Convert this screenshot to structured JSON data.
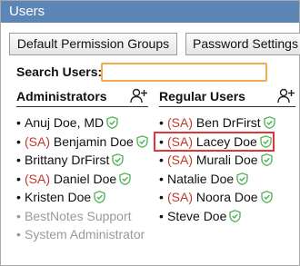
{
  "window": {
    "title": "Users"
  },
  "tabs": [
    {
      "label": "Default Permission Groups"
    },
    {
      "label": "Password Settings"
    }
  ],
  "search": {
    "label": "Search Users:",
    "value": "",
    "placeholder": ""
  },
  "administrators": {
    "title": "Administrators",
    "add_icon": "add-user-icon",
    "items": [
      {
        "prefix": "",
        "name": "Anuj Doe, MD",
        "verified": true,
        "disabled": false
      },
      {
        "prefix": "(SA)",
        "name": "Benjamin Doe",
        "verified": true,
        "disabled": false
      },
      {
        "prefix": "",
        "name": "Brittany DrFirst",
        "verified": true,
        "disabled": false
      },
      {
        "prefix": "(SA)",
        "name": "Daniel Doe",
        "verified": true,
        "disabled": false
      },
      {
        "prefix": "",
        "name": "Kristen Doe",
        "verified": true,
        "disabled": false
      },
      {
        "prefix": "",
        "name": "BestNotes Support",
        "verified": false,
        "disabled": true
      },
      {
        "prefix": "",
        "name": "System Administrator",
        "verified": false,
        "disabled": true
      }
    ]
  },
  "regular_users": {
    "title": "Regular Users",
    "add_icon": "add-user-icon",
    "items": [
      {
        "prefix": "(SA)",
        "name": "Ben DrFirst",
        "verified": true,
        "disabled": false
      },
      {
        "prefix": "(SA)",
        "name": "Lacey Doe",
        "verified": true,
        "disabled": false,
        "highlighted": true
      },
      {
        "prefix": "(SA)",
        "name": "Murali Doe",
        "verified": true,
        "disabled": false
      },
      {
        "prefix": "",
        "name": "Natalie Doe",
        "verified": true,
        "disabled": false
      },
      {
        "prefix": "(SA)",
        "name": "Noora Doe",
        "verified": true,
        "disabled": false
      },
      {
        "prefix": "",
        "name": "Steve Doe",
        "verified": true,
        "disabled": false
      }
    ]
  },
  "colors": {
    "titlebar": "#5b86b5",
    "sa_prefix": "#c0392b",
    "shield": "#4caf50",
    "highlight": "#e0363a",
    "search_border": "#f0ad4e"
  }
}
